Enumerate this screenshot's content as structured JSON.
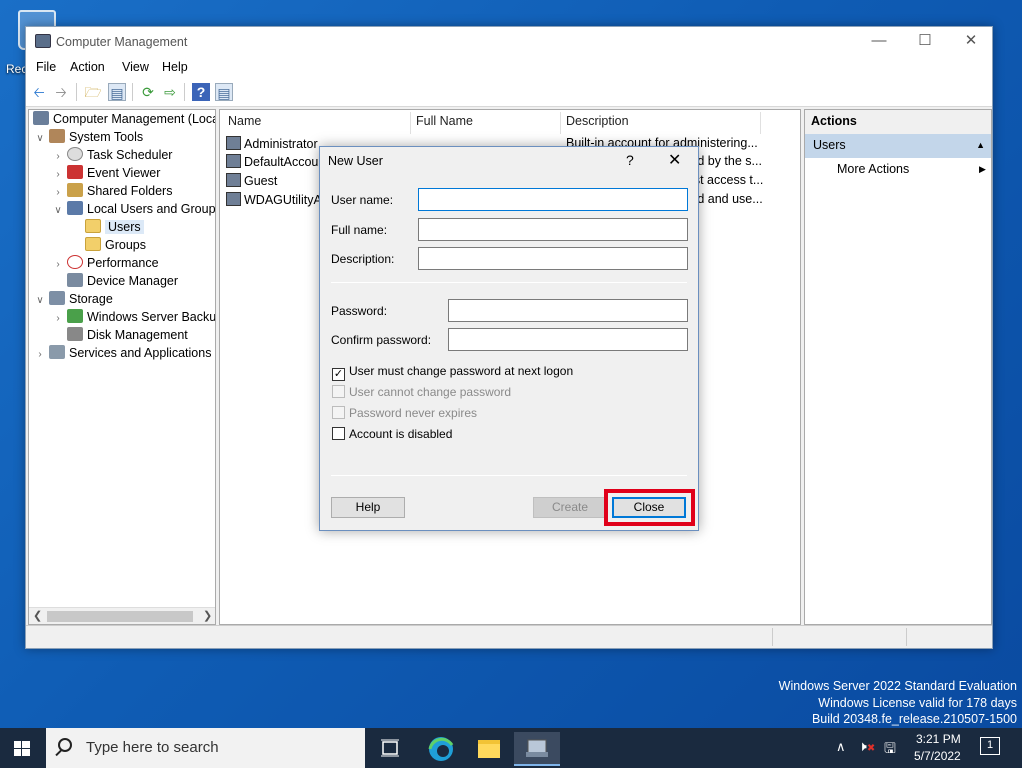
{
  "desktop": {
    "recycle_bin_label": "Rec"
  },
  "window": {
    "title": "Computer Management",
    "menu": [
      "File",
      "Action",
      "View",
      "Help"
    ],
    "tree": {
      "root": "Computer Management (Local",
      "system_tools": "System Tools",
      "task_scheduler": "Task Scheduler",
      "event_viewer": "Event Viewer",
      "shared_folders": "Shared Folders",
      "local_users": "Local Users and Groups",
      "users": "Users",
      "groups": "Groups",
      "performance": "Performance",
      "device_manager": "Device Manager",
      "storage": "Storage",
      "wsb": "Windows Server Backup",
      "disk_management": "Disk Management",
      "services": "Services and Applications"
    },
    "list": {
      "columns": [
        "Name",
        "Full Name",
        "Description"
      ],
      "rows": [
        {
          "name": "Administrator",
          "desc": "Built-in account for administering..."
        },
        {
          "name": "DefaultAccount",
          "desc": "A user account managed by the s..."
        },
        {
          "name": "Guest",
          "desc": "Built-in account for guest access t..."
        },
        {
          "name": "WDAGUtilityAccount",
          "desc": "A user account managed and use..."
        }
      ]
    },
    "actions": {
      "header": "Actions",
      "section": "Users",
      "more": "More Actions"
    }
  },
  "dialog": {
    "title": "New User",
    "help_glyph": "?",
    "close_glyph": "✕",
    "user_name_label": "User name:",
    "full_name_label": "Full name:",
    "description_label": "Description:",
    "password_label": "Password:",
    "confirm_label": "Confirm password:",
    "must_change": "User must change password at next logon",
    "cannot_change": "User cannot change password",
    "never_expires": "Password never expires",
    "disabled": "Account is disabled",
    "help_btn": "Help",
    "create_btn": "Create",
    "close_btn": "Close"
  },
  "watermark": {
    "line1": "Windows Server 2022 Standard Evaluation",
    "line2": "Windows License valid for 178 days",
    "line3": "Build 20348.fe_release.210507-1500"
  },
  "taskbar": {
    "search_placeholder": "Type here to search",
    "time": "3:21 PM",
    "date": "5/7/2022",
    "notif_count": "1"
  }
}
